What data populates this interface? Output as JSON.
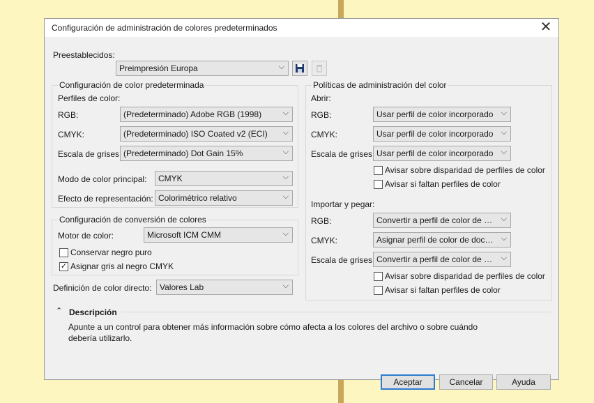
{
  "window": {
    "title": "Configuración de administración de colores predeterminados"
  },
  "presets": {
    "label": "Preestablecidos:",
    "value": "Preimpresión Europa"
  },
  "default_color": {
    "group_title": "Configuración de color predeterminada",
    "profiles_label": "Perfiles de color:",
    "rgb_label": "RGB:",
    "rgb_value": "(Predeterminado) Adobe RGB (1998)",
    "cmyk_label": "CMYK:",
    "cmyk_value": "(Predeterminado) ISO Coated v2 (ECI)",
    "gray_label": "Escala de grises:",
    "gray_value": "(Predeterminado) Dot Gain 15%",
    "primary_mode_label": "Modo de color principal:",
    "primary_mode_value": "CMYK",
    "rendering_label": "Efecto de representación:",
    "rendering_value": "Colorimétrico relativo"
  },
  "conversion": {
    "group_title": "Configuración de conversión de colores",
    "engine_label": "Motor de color:",
    "engine_value": "Microsoft ICM CMM",
    "preserve_black_label": "Conservar negro puro",
    "preserve_black_checked": false,
    "gray_to_black_label": "Asignar gris al negro CMYK",
    "gray_to_black_checked": true
  },
  "spot": {
    "label": "Definición de color directo:",
    "value": "Valores Lab"
  },
  "policies": {
    "group_title": "Políticas de administración del color",
    "open": {
      "heading": "Abrir:",
      "rgb_label": "RGB:",
      "rgb_value": "Usar perfil de color incorporado",
      "cmyk_label": "CMYK:",
      "cmyk_value": "Usar perfil de color incorporado",
      "gray_label": "Escala de grises:",
      "gray_value": "Usar perfil de color incorporado",
      "mismatch_label": "Avisar sobre disparidad de perfiles de color",
      "mismatch_checked": false,
      "missing_label": "Avisar si faltan perfiles de color",
      "missing_checked": false
    },
    "import": {
      "heading": "Importar y pegar:",
      "rgb_label": "RGB:",
      "rgb_value": "Convertir a perfil de color de d...",
      "cmyk_label": "CMYK:",
      "cmyk_value": "Asignar perfil de color de docu...",
      "gray_label": "Escala de grises:",
      "gray_value": "Convertir a perfil de color de d...",
      "mismatch_label": "Avisar sobre disparidad de perfiles de color",
      "mismatch_checked": false,
      "missing_label": "Avisar si faltan perfiles de color",
      "missing_checked": false
    }
  },
  "description": {
    "heading": "Descripción",
    "text": "Apunte a un control para obtener más información sobre cómo afecta a los colores del archivo o sobre cuándo debería utilizarlo."
  },
  "buttons": {
    "ok": "Aceptar",
    "cancel": "Cancelar",
    "help": "Ayuda"
  }
}
